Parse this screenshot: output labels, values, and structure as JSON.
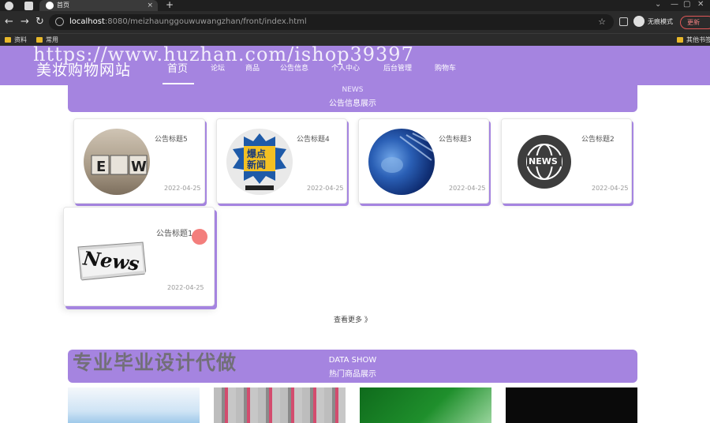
{
  "browser": {
    "tab_title": "首页",
    "tab_close": "×",
    "new_tab": "+",
    "window_controls": [
      "⌄",
      "—",
      "▢",
      "✕"
    ],
    "url_host": "localhost",
    "url_rest": ":8080/meizhaunggouwuwangzhan/front/index.html",
    "incognito_label": "无痕模式",
    "update_label": "更新",
    "bookmarks": [
      "资料",
      "常用"
    ],
    "other_bookmarks": "其他书签"
  },
  "watermark": "https://www.huzhan.com/ishop39397",
  "site": {
    "logo": "美妆购物网站",
    "menu": [
      "首页",
      "论坛",
      "商品",
      "公告信息",
      "个人中心",
      "后台管理",
      "购物车"
    ]
  },
  "news_section": {
    "title_en": "NEWS",
    "title_cn": "公告信息展示",
    "items": [
      {
        "title": "公告标题5",
        "date": "2022-04-25",
        "image": "ew-letter-blocks"
      },
      {
        "title": "公告标题4",
        "date": "2022-04-25",
        "image": "breaking-news-badge"
      },
      {
        "title": "公告标题3",
        "date": "2022-04-25",
        "image": "globe-satellite"
      },
      {
        "title": "公告标题2",
        "date": "2022-04-25",
        "image": "globe-news-icon"
      },
      {
        "title": "公告标题1",
        "date": "2022-04-25",
        "image": "newspaper"
      }
    ],
    "more_label": "查看更多 》"
  },
  "ad_text": "专业毕业设计代做",
  "data_section": {
    "title_en": "DATA SHOW",
    "title_cn": "热门商品展示"
  },
  "thumb_text": {
    "ew": "E W",
    "breaking_news": "爆点新闻",
    "globe_news": "NEWS",
    "newspaper": "News"
  },
  "colors": {
    "theme_purple": "#a584e0",
    "browser_dark": "#2b2b2b"
  }
}
